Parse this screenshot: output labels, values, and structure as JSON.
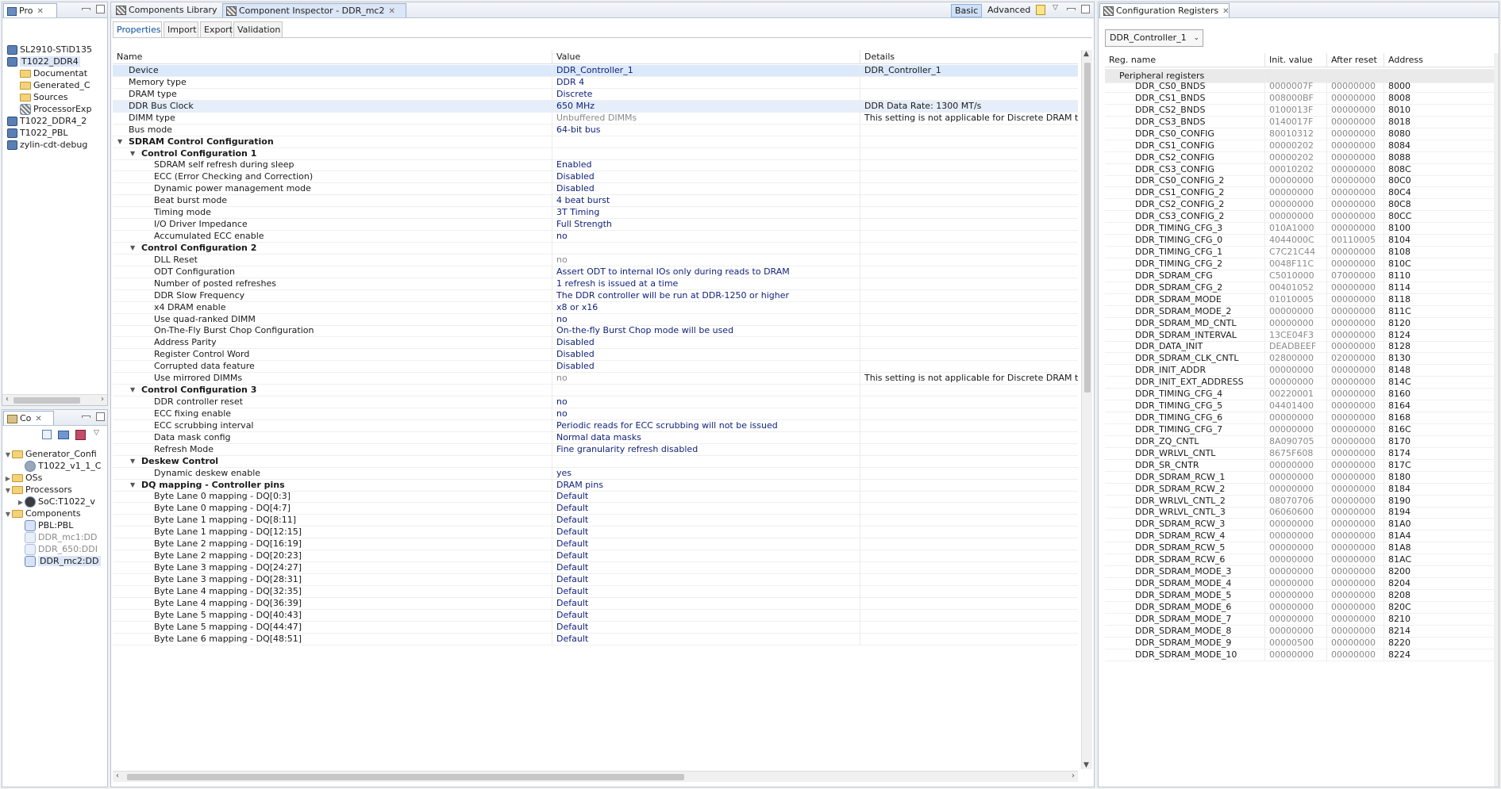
{
  "left_top": {
    "tab_label": "Pro",
    "items": [
      {
        "label": "SL2910-STiD135",
        "depth": 0,
        "type": "project",
        "expanded": false
      },
      {
        "label": "T1022_DDR4",
        "depth": 0,
        "type": "project",
        "expanded": true,
        "selected": true
      },
      {
        "label": "Documentat",
        "depth": 1,
        "type": "folder"
      },
      {
        "label": "Generated_C",
        "depth": 1,
        "type": "folder"
      },
      {
        "label": "Sources",
        "depth": 1,
        "type": "folder"
      },
      {
        "label": "ProcessorExp",
        "depth": 1,
        "type": "file"
      },
      {
        "label": "T1022_DDR4_2",
        "depth": 0,
        "type": "project"
      },
      {
        "label": "T1022_PBL",
        "depth": 0,
        "type": "project"
      },
      {
        "label": "zylin-cdt-debug",
        "depth": 0,
        "type": "project"
      }
    ]
  },
  "left_bottom": {
    "tab_label": "Co",
    "items": [
      {
        "label": "Generator_Confi",
        "depth": 0,
        "type": "folder",
        "arrow": "down"
      },
      {
        "label": "T1022_v1_1_C",
        "depth": 1,
        "type": "gear"
      },
      {
        "label": "OSs",
        "depth": 0,
        "type": "folder",
        "arrow": "right"
      },
      {
        "label": "Processors",
        "depth": 0,
        "type": "folder",
        "arrow": "down"
      },
      {
        "label": "SoC:T1022_v",
        "depth": 1,
        "type": "chip",
        "arrow": "right"
      },
      {
        "label": "Components",
        "depth": 0,
        "type": "folder",
        "arrow": "down"
      },
      {
        "label": "PBL:PBL",
        "depth": 1,
        "type": "comp"
      },
      {
        "label": "DDR_mc1:DD",
        "depth": 1,
        "type": "comp",
        "dim": true
      },
      {
        "label": "DDR_650:DDI",
        "depth": 1,
        "type": "comp",
        "dim": true
      },
      {
        "label": "DDR_mc2:DD",
        "depth": 1,
        "type": "comp",
        "selected": true
      }
    ]
  },
  "center": {
    "tabs": [
      {
        "label": "Components Library",
        "active": false
      },
      {
        "label": "Component Inspector - DDR_mc2",
        "active": true
      }
    ],
    "mode_basic": "Basic",
    "mode_advanced": "Advanced",
    "subtabs": [
      "Properties",
      "Import",
      "Export",
      "Validation"
    ],
    "columns": {
      "name": "Name",
      "value": "Value",
      "details": "Details"
    },
    "rows": [
      {
        "name": "Device",
        "value": "DDR_Controller_1",
        "details": "DDR_Controller_1",
        "depth": 0,
        "selected": true
      },
      {
        "name": "Memory type",
        "value": "DDR 4",
        "details": "",
        "depth": 0
      },
      {
        "name": "DRAM type",
        "value": "Discrete",
        "details": "",
        "depth": 0
      },
      {
        "name": "DDR Bus Clock",
        "value": "650 MHz",
        "details": "DDR Data Rate:    1300 MT/s",
        "depth": 0,
        "highlight": true
      },
      {
        "name": "DIMM type",
        "value": "Unbuffered DIMMs",
        "details": "This setting is not applicable for Discrete DRAM ty",
        "depth": 0,
        "gray": true
      },
      {
        "name": "Bus mode",
        "value": "64-bit bus",
        "details": "",
        "depth": 0
      },
      {
        "name": "SDRAM Control Configuration",
        "value": "",
        "details": "",
        "depth": 0,
        "group": true
      },
      {
        "name": "Control Configuration 1",
        "value": "",
        "details": "",
        "depth": 1,
        "group": true
      },
      {
        "name": "SDRAM self refresh during sleep",
        "value": "Enabled",
        "details": "",
        "depth": 2
      },
      {
        "name": "ECC (Error Checking and Correction)",
        "value": "Disabled",
        "details": "",
        "depth": 2
      },
      {
        "name": "Dynamic power management mode",
        "value": "Disabled",
        "details": "",
        "depth": 2
      },
      {
        "name": "Beat burst mode",
        "value": "4 beat burst",
        "details": "",
        "depth": 2
      },
      {
        "name": "Timing mode",
        "value": "3T Timing",
        "details": "",
        "depth": 2
      },
      {
        "name": "I/O Driver Impedance",
        "value": "Full Strength",
        "details": "",
        "depth": 2
      },
      {
        "name": "Accumulated ECC enable",
        "value": "no",
        "details": "",
        "depth": 2
      },
      {
        "name": "Control Configuration 2",
        "value": "",
        "details": "",
        "depth": 1,
        "group": true
      },
      {
        "name": "DLL Reset",
        "value": "no",
        "details": "",
        "depth": 2,
        "gray": true
      },
      {
        "name": "ODT Configuration",
        "value": "Assert ODT to internal IOs only during reads to DRAM",
        "details": "",
        "depth": 2
      },
      {
        "name": "Number of posted refreshes",
        "value": "1 refresh is issued at a time",
        "details": "",
        "depth": 2
      },
      {
        "name": "DDR Slow Frequency",
        "value": "The DDR controller will be run at DDR-1250 or higher",
        "details": "",
        "depth": 2
      },
      {
        "name": "x4 DRAM enable",
        "value": "x8 or x16",
        "details": "",
        "depth": 2
      },
      {
        "name": "Use quad-ranked DIMM",
        "value": "no",
        "details": "",
        "depth": 2
      },
      {
        "name": "On-The-Fly Burst Chop Configuration",
        "value": "On-the-fly Burst Chop mode will be used",
        "details": "",
        "depth": 2
      },
      {
        "name": "Address Parity",
        "value": "Disabled",
        "details": "",
        "depth": 2
      },
      {
        "name": "Register Control Word",
        "value": "Disabled",
        "details": "",
        "depth": 2
      },
      {
        "name": "Corrupted data feature",
        "value": "Disabled",
        "details": "",
        "depth": 2
      },
      {
        "name": "Use mirrored DIMMs",
        "value": "no",
        "details": "This setting is not applicable for Discrete DRAM ty",
        "depth": 2,
        "gray": true
      },
      {
        "name": "Control Configuration 3",
        "value": "",
        "details": "",
        "depth": 1,
        "group": true
      },
      {
        "name": "DDR controller reset",
        "value": "no",
        "details": "",
        "depth": 2
      },
      {
        "name": "ECC fixing enable",
        "value": "no",
        "details": "",
        "depth": 2
      },
      {
        "name": "ECC scrubbing interval",
        "value": "Periodic reads for ECC scrubbing will not be issued",
        "details": "",
        "depth": 2
      },
      {
        "name": "Data mask config",
        "value": "Normal data masks",
        "details": "",
        "depth": 2
      },
      {
        "name": "Refresh Mode",
        "value": "Fine granularity refresh disabled",
        "details": "",
        "depth": 2
      },
      {
        "name": "Deskew Control",
        "value": "",
        "details": "",
        "depth": 1,
        "group": true
      },
      {
        "name": "Dynamic deskew enable",
        "value": "yes",
        "details": "",
        "depth": 2
      },
      {
        "name": "DQ mapping - Controller pins",
        "value": "DRAM pins",
        "details": "",
        "depth": 1,
        "group": true
      },
      {
        "name": "Byte Lane 0 mapping - DQ[0:3]",
        "value": "Default",
        "details": "",
        "depth": 2
      },
      {
        "name": "Byte Lane 0 mapping - DQ[4:7]",
        "value": "Default",
        "details": "",
        "depth": 2
      },
      {
        "name": "Byte Lane 1 mapping - DQ[8:11]",
        "value": "Default",
        "details": "",
        "depth": 2
      },
      {
        "name": "Byte Lane 1 mapping - DQ[12:15]",
        "value": "Default",
        "details": "",
        "depth": 2
      },
      {
        "name": "Byte Lane 2 mapping - DQ[16:19]",
        "value": "Default",
        "details": "",
        "depth": 2
      },
      {
        "name": "Byte Lane 2 mapping - DQ[20:23]",
        "value": "Default",
        "details": "",
        "depth": 2
      },
      {
        "name": "Byte Lane 3 mapping - DQ[24:27]",
        "value": "Default",
        "details": "",
        "depth": 2
      },
      {
        "name": "Byte Lane 3 mapping - DQ[28:31]",
        "value": "Default",
        "details": "",
        "depth": 2
      },
      {
        "name": "Byte Lane 4 mapping - DQ[32:35]",
        "value": "Default",
        "details": "",
        "depth": 2
      },
      {
        "name": "Byte Lane 4 mapping - DQ[36:39]",
        "value": "Default",
        "details": "",
        "depth": 2
      },
      {
        "name": "Byte Lane 5 mapping - DQ[40:43]",
        "value": "Default",
        "details": "",
        "depth": 2
      },
      {
        "name": "Byte Lane 5 mapping - DQ[44:47]",
        "value": "Default",
        "details": "",
        "depth": 2
      },
      {
        "name": "Byte Lane 6 mapping - DQ[48:51]",
        "value": "Default",
        "details": "",
        "depth": 2
      }
    ]
  },
  "right": {
    "tab_label": "Configuration Registers",
    "dropdown_value": "DDR_Controller_1",
    "columns": {
      "name": "Reg. name",
      "init": "Init. value",
      "after": "After reset",
      "address": "Address"
    },
    "group_label": "Peripheral registers",
    "rows": [
      {
        "name": "DDR_CS0_BNDS",
        "init": "0000007F",
        "after": "00000000",
        "address": "8000"
      },
      {
        "name": "DDR_CS1_BNDS",
        "init": "008000BF",
        "after": "00000000",
        "address": "8008"
      },
      {
        "name": "DDR_CS2_BNDS",
        "init": "0100013F",
        "after": "00000000",
        "address": "8010"
      },
      {
        "name": "DDR_CS3_BNDS",
        "init": "0140017F",
        "after": "00000000",
        "address": "8018"
      },
      {
        "name": "DDR_CS0_CONFIG",
        "init": "80010312",
        "after": "00000000",
        "address": "8080"
      },
      {
        "name": "DDR_CS1_CONFIG",
        "init": "00000202",
        "after": "00000000",
        "address": "8084"
      },
      {
        "name": "DDR_CS2_CONFIG",
        "init": "00000202",
        "after": "00000000",
        "address": "8088"
      },
      {
        "name": "DDR_CS3_CONFIG",
        "init": "00010202",
        "after": "00000000",
        "address": "808C"
      },
      {
        "name": "DDR_CS0_CONFIG_2",
        "init": "00000000",
        "after": "00000000",
        "address": "80C0"
      },
      {
        "name": "DDR_CS1_CONFIG_2",
        "init": "00000000",
        "after": "00000000",
        "address": "80C4"
      },
      {
        "name": "DDR_CS2_CONFIG_2",
        "init": "00000000",
        "after": "00000000",
        "address": "80C8"
      },
      {
        "name": "DDR_CS3_CONFIG_2",
        "init": "00000000",
        "after": "00000000",
        "address": "80CC"
      },
      {
        "name": "DDR_TIMING_CFG_3",
        "init": "010A1000",
        "after": "00000000",
        "address": "8100"
      },
      {
        "name": "DDR_TIMING_CFG_0",
        "init": "4044000C",
        "after": "00110005",
        "address": "8104"
      },
      {
        "name": "DDR_TIMING_CFG_1",
        "init": "C7C21C44",
        "after": "00000000",
        "address": "8108"
      },
      {
        "name": "DDR_TIMING_CFG_2",
        "init": "0048F11C",
        "after": "00000000",
        "address": "810C"
      },
      {
        "name": "DDR_SDRAM_CFG",
        "init": "C5010000",
        "after": "07000000",
        "address": "8110"
      },
      {
        "name": "DDR_SDRAM_CFG_2",
        "init": "00401052",
        "after": "00000000",
        "address": "8114"
      },
      {
        "name": "DDR_SDRAM_MODE",
        "init": "01010005",
        "after": "00000000",
        "address": "8118"
      },
      {
        "name": "DDR_SDRAM_MODE_2",
        "init": "00000000",
        "after": "00000000",
        "address": "811C"
      },
      {
        "name": "DDR_SDRAM_MD_CNTL",
        "init": "00000000",
        "after": "00000000",
        "address": "8120"
      },
      {
        "name": "DDR_SDRAM_INTERVAL",
        "init": "13CE04F3",
        "after": "00000000",
        "address": "8124"
      },
      {
        "name": "DDR_DATA_INIT",
        "init": "DEADBEEF",
        "after": "00000000",
        "address": "8128"
      },
      {
        "name": "DDR_SDRAM_CLK_CNTL",
        "init": "02800000",
        "after": "02000000",
        "address": "8130"
      },
      {
        "name": "DDR_INIT_ADDR",
        "init": "00000000",
        "after": "00000000",
        "address": "8148"
      },
      {
        "name": "DDR_INIT_EXT_ADDRESS",
        "init": "00000000",
        "after": "00000000",
        "address": "814C"
      },
      {
        "name": "DDR_TIMING_CFG_4",
        "init": "00220001",
        "after": "00000000",
        "address": "8160"
      },
      {
        "name": "DDR_TIMING_CFG_5",
        "init": "04401400",
        "after": "00000000",
        "address": "8164"
      },
      {
        "name": "DDR_TIMING_CFG_6",
        "init": "00000000",
        "after": "00000000",
        "address": "8168"
      },
      {
        "name": "DDR_TIMING_CFG_7",
        "init": "00000000",
        "after": "00000000",
        "address": "816C"
      },
      {
        "name": "DDR_ZQ_CNTL",
        "init": "8A090705",
        "after": "00000000",
        "address": "8170"
      },
      {
        "name": "DDR_WRLVL_CNTL",
        "init": "8675F608",
        "after": "00000000",
        "address": "8174"
      },
      {
        "name": "DDR_SR_CNTR",
        "init": "00000000",
        "after": "00000000",
        "address": "817C"
      },
      {
        "name": "DDR_SDRAM_RCW_1",
        "init": "00000000",
        "after": "00000000",
        "address": "8180"
      },
      {
        "name": "DDR_SDRAM_RCW_2",
        "init": "00000000",
        "after": "00000000",
        "address": "8184"
      },
      {
        "name": "DDR_WRLVL_CNTL_2",
        "init": "08070706",
        "after": "00000000",
        "address": "8190"
      },
      {
        "name": "DDR_WRLVL_CNTL_3",
        "init": "06060600",
        "after": "00000000",
        "address": "8194"
      },
      {
        "name": "DDR_SDRAM_RCW_3",
        "init": "00000000",
        "after": "00000000",
        "address": "81A0"
      },
      {
        "name": "DDR_SDRAM_RCW_4",
        "init": "00000000",
        "after": "00000000",
        "address": "81A4"
      },
      {
        "name": "DDR_SDRAM_RCW_5",
        "init": "00000000",
        "after": "00000000",
        "address": "81A8"
      },
      {
        "name": "DDR_SDRAM_RCW_6",
        "init": "00000000",
        "after": "00000000",
        "address": "81AC"
      },
      {
        "name": "DDR_SDRAM_MODE_3",
        "init": "00000000",
        "after": "00000000",
        "address": "8200"
      },
      {
        "name": "DDR_SDRAM_MODE_4",
        "init": "00000000",
        "after": "00000000",
        "address": "8204"
      },
      {
        "name": "DDR_SDRAM_MODE_5",
        "init": "00000000",
        "after": "00000000",
        "address": "8208"
      },
      {
        "name": "DDR_SDRAM_MODE_6",
        "init": "00000000",
        "after": "00000000",
        "address": "820C"
      },
      {
        "name": "DDR_SDRAM_MODE_7",
        "init": "00000000",
        "after": "00000000",
        "address": "8210"
      },
      {
        "name": "DDR_SDRAM_MODE_8",
        "init": "00000000",
        "after": "00000000",
        "address": "8214"
      },
      {
        "name": "DDR_SDRAM_MODE_9",
        "init": "00000500",
        "after": "00000000",
        "address": "8220"
      },
      {
        "name": "DDR_SDRAM_MODE_10",
        "init": "00000000",
        "after": "00000000",
        "address": "8224"
      }
    ]
  }
}
